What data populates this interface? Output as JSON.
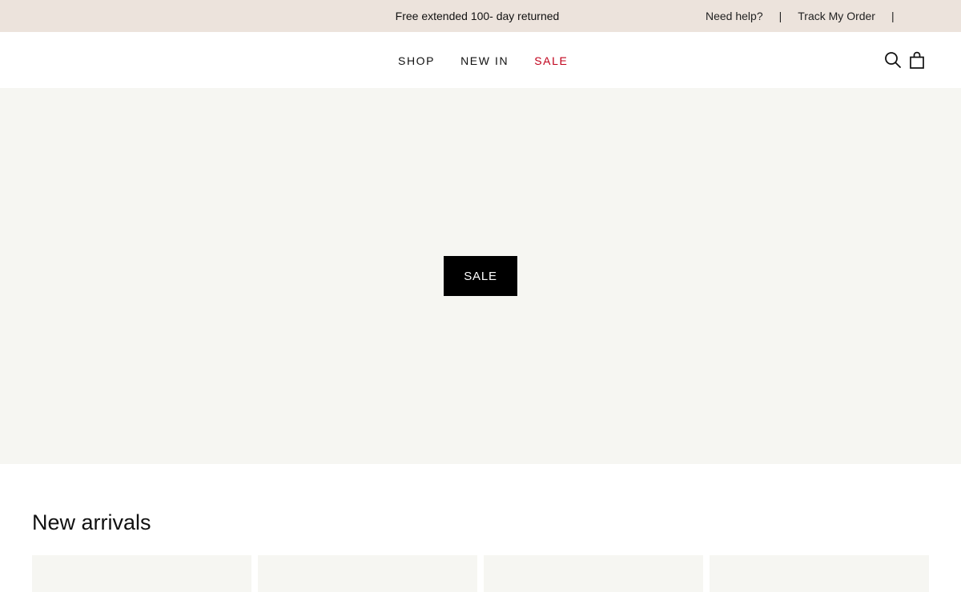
{
  "topbar": {
    "promo": "Free extended 100- day returned",
    "need_help": "Need help?",
    "separator": "|",
    "track_order": "Track My Order"
  },
  "nav": {
    "items": [
      {
        "label": "SHOP"
      },
      {
        "label": "NEW IN"
      },
      {
        "label": "SALE",
        "color": "#c0001a"
      }
    ]
  },
  "header": {
    "icons": [
      "search-icon",
      "bag-icon"
    ]
  },
  "hero": {
    "button_label": "SALE",
    "background": "#f6f6f2"
  },
  "new_arrivals": {
    "title": "New arrivals",
    "card_count": 4
  },
  "colors": {
    "topbar_bg": "#ece3dc",
    "accent_sale": "#c0001a",
    "button_bg": "#000000"
  }
}
